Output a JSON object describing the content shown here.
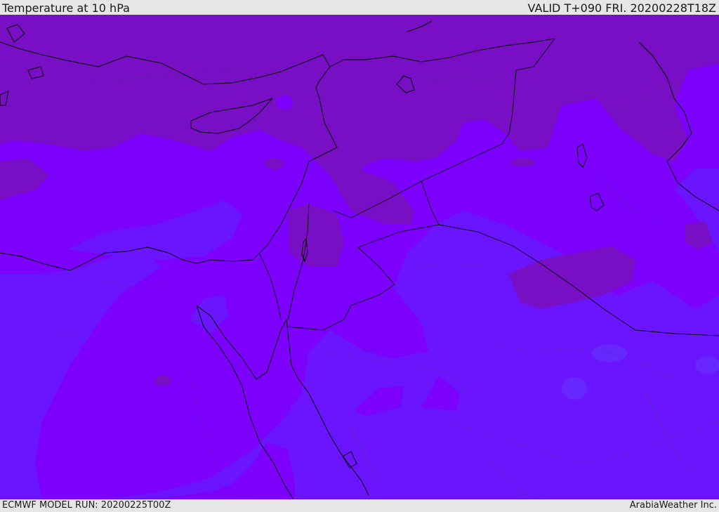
{
  "header": {
    "title": "Temperature at 10 hPa",
    "valid_time": "VALID T+090 FRI. 20200228T18Z"
  },
  "footer": {
    "model_run": "ECMWF MODEL RUN: 20200225T00Z",
    "credit": "ArabiaWeather Inc."
  },
  "colors": {
    "band_dark": "#780fc4",
    "band_mid": "#7d00ff",
    "band_light": "#6a14ff",
    "coastline": "#000000",
    "border_dotted": "#4a2c8a",
    "bar_background": "#e6e6e6"
  }
}
